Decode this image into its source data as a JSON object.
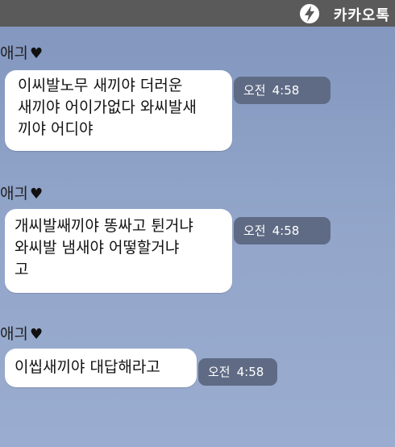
{
  "app": {
    "name": "카카오톡",
    "logo_icon": "lightning-bolt-icon"
  },
  "messages": [
    {
      "sender": "애긔",
      "text": "이씨발노무 새끼야 더러운\n새끼야 어이가없다 와씨발새\n끼야 어디야",
      "time_period": "오전",
      "time": "4:58"
    },
    {
      "sender": "애긔",
      "text": "개씨발쌔끼야 똥싸고 튄거냐\n와씨발 냄새야 어떻할거냐\n고",
      "time_period": "오전",
      "time": "4:58"
    },
    {
      "sender": "애긔",
      "text": "이씹새끼야 대답해라고",
      "time_period": "오전",
      "time": "4:58"
    }
  ],
  "colors": {
    "topbar": "#5a5a5a",
    "chat_background": "#8fa3c7",
    "bubble": "#ffffff",
    "time_badge": "#5f6b85"
  }
}
